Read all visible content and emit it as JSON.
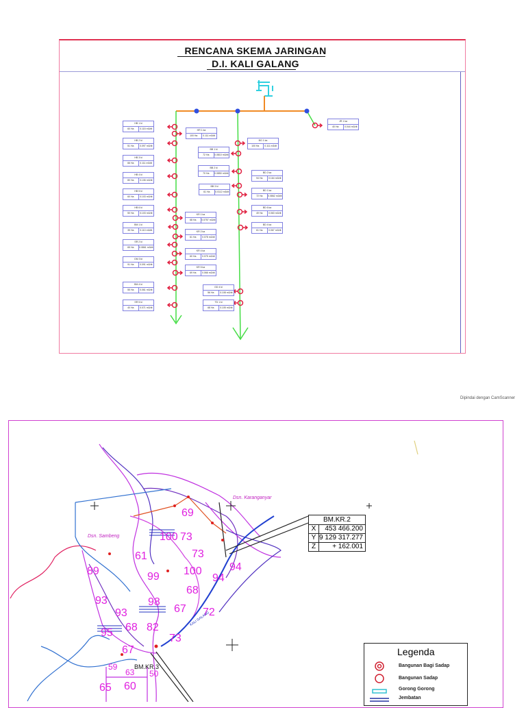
{
  "schema": {
    "title_line1": "RENCANA SKEMA JARINGAN",
    "title_line2": "D.I. KALI GALANG",
    "left_boxes": [
      {
        "name": "HB 1 ki",
        "area": "60 Ha",
        "flow": "0.115 m3/dt"
      },
      {
        "name": "HB 2 ki",
        "area": "51 Ha",
        "flow": "0.097 m3/dt"
      },
      {
        "name": "HB 3 ki",
        "area": "66 Ha",
        "flow": "0.111 m3/dt"
      },
      {
        "name": "HB 4 ki",
        "area": "80 Ha",
        "flow": "0.106 m3/dt"
      },
      {
        "name": "HB 5 ki",
        "area": "60 Ha",
        "flow": "0.103 m3/dt"
      },
      {
        "name": "HB 6 ki",
        "area": "50 Ha",
        "flow": "0.103 m3/dt"
      },
      {
        "name": "BM 1 ki",
        "area": "35 Ha",
        "flow": "0.110 m3/dt"
      },
      {
        "name": "SR 2 ki",
        "area": "65 Ha",
        "flow": "0.0861 m3/dt"
      },
      {
        "name": "GM 3 ki",
        "area": "91 Ha",
        "flow": "0.091 m3/dt"
      },
      {
        "name": "BM 4 ki",
        "area": "55 Ha",
        "flow": "0.061 m3/dt"
      },
      {
        "name": "SR 5 ki",
        "area": "40 Ha",
        "flow": "0.071 m3/dt"
      }
    ],
    "mid_boxes": [
      {
        "name": "HR 1 ka",
        "area": "100 Ha",
        "flow": "0.111 m3/dt"
      },
      {
        "name": "BB 1 ki",
        "area": "72 Ha",
        "flow": "0.0810 m3/dt"
      },
      {
        "name": "BB 2 ki",
        "area": "70 Ha",
        "flow": "0.0850 m3/dt"
      },
      {
        "name": "BB 3 ki",
        "area": "61 Ha",
        "flow": "0.0112 m3/dt"
      },
      {
        "name": "KR 1 ka",
        "area": "68 Ha",
        "flow": "0.0757 m3/dt"
      },
      {
        "name": "KR 2 ka",
        "area": "61 Ha",
        "flow": "0.078 m3/dt"
      },
      {
        "name": "KR 4 ka",
        "area": "60 Ha",
        "flow": "0.075 m3/dt"
      },
      {
        "name": "KR 5 ka",
        "area": "69 Ha",
        "flow": "0.066 m3/dt"
      },
      {
        "name": "GD 4 ki",
        "area": "56 Ha",
        "flow": "0.108 m3/dt"
      },
      {
        "name": "TD 1 ki",
        "area": "68 Ha",
        "flow": "0.105 m3/dt"
      }
    ],
    "right_boxes": [
      {
        "name": "BG 1 ka",
        "area": "100 Ha",
        "flow": "0.111 m3/dt"
      },
      {
        "name": "BD 2 ka",
        "area": "94 Ha",
        "flow": "0.164 m3/dt"
      },
      {
        "name": "BD 1 ka",
        "area": "72 Ha",
        "flow": "0.0862 m3/dt"
      },
      {
        "name": "BD 6 ka",
        "area": "49 Ha",
        "flow": "0.063 m3/dt"
      },
      {
        "name": "BD 4 ka",
        "area": "61 Ha",
        "flow": "0.067 m3/dt"
      },
      {
        "name": "JR 1 ka",
        "area": "40 Ha",
        "flow": "0.044 m3/dt"
      }
    ],
    "colors": {
      "main_canal": "#f08a24",
      "secondary": "#44dd44",
      "node": "#3050e0",
      "offtake": "#e02040",
      "box_border": "#8080e0"
    }
  },
  "scanner_note": "Dipindai dengan CamScanner",
  "map": {
    "places": [
      "Dsn. Sambeng",
      "Dsn. Karanganyar"
    ],
    "area_labels": [
      "69",
      "100",
      "73",
      "73",
      "100",
      "94",
      "94",
      "89",
      "99",
      "61",
      "68",
      "98",
      "67",
      "72",
      "93",
      "93",
      "68",
      "82",
      "73",
      "95",
      "67",
      "59",
      "63",
      "50",
      "65",
      "60"
    ],
    "bm3_label": "BM.KR.3",
    "river_label": "KALI GALANG",
    "bm2": {
      "title": "BM.KR.2",
      "rows": [
        {
          "k": "X",
          "v": "453 466.200"
        },
        {
          "k": "Y",
          "v": "9 129 317.277"
        },
        {
          "k": "Z",
          "v": "+ 162.001"
        }
      ]
    },
    "legend": {
      "title": "Legenda",
      "items": [
        "Bangunan Bagi Sadap",
        "Bangunan Sadap",
        "Gorong Gorong",
        "Jembatan"
      ]
    }
  }
}
